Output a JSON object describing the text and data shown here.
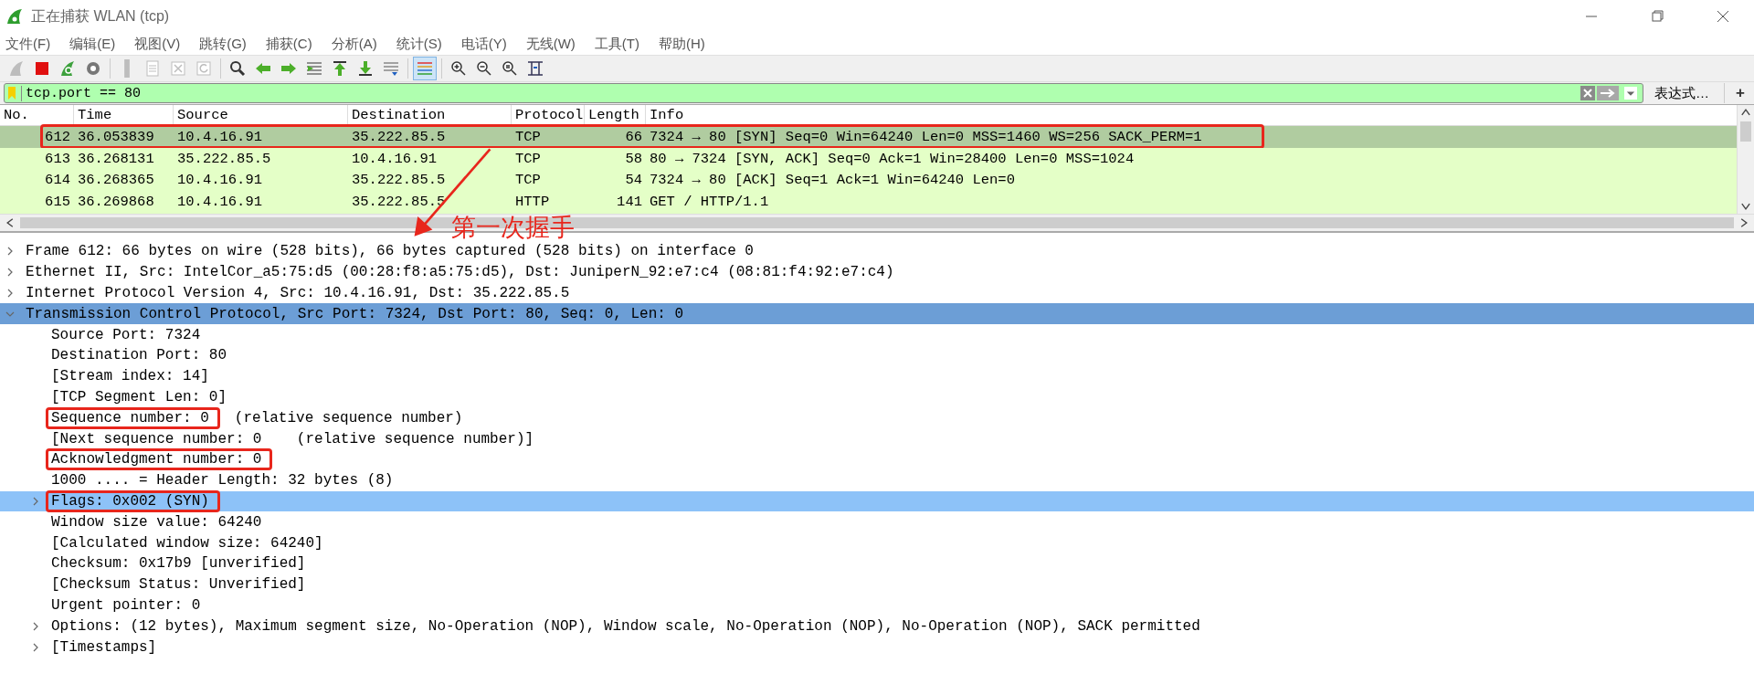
{
  "window": {
    "title": "正在捕获 WLAN (tcp)"
  },
  "menu": [
    "文件(F)",
    "编辑(E)",
    "视图(V)",
    "跳转(G)",
    "捕获(C)",
    "分析(A)",
    "统计(S)",
    "电话(Y)",
    "无线(W)",
    "工具(T)",
    "帮助(H)"
  ],
  "toolbar": [
    [
      {
        "kind": "start",
        "disabled": true,
        "pressed": false
      },
      {
        "kind": "stop",
        "disabled": false,
        "pressed": false
      },
      {
        "kind": "restart",
        "disabled": false,
        "pressed": false
      },
      {
        "kind": "options",
        "disabled": false,
        "pressed": false
      }
    ],
    [
      {
        "kind": "open",
        "disabled": true,
        "pressed": false
      },
      {
        "kind": "save",
        "disabled": true,
        "pressed": false
      },
      {
        "kind": "close",
        "disabled": true,
        "pressed": false
      },
      {
        "kind": "reload",
        "disabled": true,
        "pressed": false
      }
    ],
    [
      {
        "kind": "find",
        "disabled": false,
        "pressed": false
      },
      {
        "kind": "back",
        "disabled": false,
        "pressed": false
      },
      {
        "kind": "forward",
        "disabled": false,
        "pressed": false
      },
      {
        "kind": "goto",
        "disabled": false,
        "pressed": false
      },
      {
        "kind": "first",
        "disabled": false,
        "pressed": false
      },
      {
        "kind": "last",
        "disabled": false,
        "pressed": false
      },
      {
        "kind": "autoscroll",
        "disabled": false,
        "pressed": false
      }
    ],
    [
      {
        "kind": "colorize",
        "disabled": false,
        "pressed": true
      }
    ],
    [
      {
        "kind": "zoom_in",
        "disabled": false,
        "pressed": false
      },
      {
        "kind": "zoom_out",
        "disabled": false,
        "pressed": false
      },
      {
        "kind": "zoom_reset",
        "disabled": false,
        "pressed": false
      },
      {
        "kind": "resize",
        "disabled": false,
        "pressed": false
      }
    ]
  ],
  "filter": {
    "value": "tcp.port == 80",
    "expression_button": "表达式…",
    "add_button": "+"
  },
  "packet_list": {
    "columns": [
      "No.",
      "Time",
      "Source",
      "Destination",
      "Protocol",
      "Length",
      "Info"
    ],
    "rows": [
      {
        "no": "612",
        "time": "36.053839",
        "source": "10.4.16.91",
        "destination": "35.222.85.5",
        "protocol": "TCP",
        "length": "66",
        "info": "7324 → 80 [SYN] Seq=0 Win=64240 Len=0 MSS=1460 WS=256 SACK_PERM=1",
        "selected": true,
        "annotated": true
      },
      {
        "no": "613",
        "time": "36.268131",
        "source": "35.222.85.5",
        "destination": "10.4.16.91",
        "protocol": "TCP",
        "length": "58",
        "info": "80 → 7324 [SYN, ACK] Seq=0 Ack=1 Win=28400 Len=0 MSS=1024",
        "selected": false,
        "annotated": false
      },
      {
        "no": "614",
        "time": "36.268365",
        "source": "10.4.16.91",
        "destination": "35.222.85.5",
        "protocol": "TCP",
        "length": "54",
        "info": "7324 → 80 [ACK] Seq=1 Ack=1 Win=64240 Len=0",
        "selected": false,
        "annotated": false
      },
      {
        "no": "615",
        "time": "36.269868",
        "source": "10.4.16.91",
        "destination": "35.222.85.5",
        "protocol": "HTTP",
        "length": "141",
        "info": "GET / HTTP/1.1",
        "selected": false,
        "annotated": false
      }
    ]
  },
  "annotation": {
    "text": "第一次握手"
  },
  "details": [
    {
      "text": "Frame 612: 66 bytes on wire (528 bits), 66 bytes captured (528 bits) on interface 0",
      "expanded": false,
      "selected": false,
      "parent_of_selected": false,
      "annotated": false
    },
    {
      "text": "Ethernet II, Src: IntelCor_a5:75:d5 (00:28:f8:a5:75:d5), Dst: JuniperN_92:e7:c4 (08:81:f4:92:e7:c4)",
      "expanded": false,
      "selected": false,
      "parent_of_selected": false,
      "annotated": false
    },
    {
      "text": "Internet Protocol Version 4, Src: 10.4.16.91, Dst: 35.222.85.5",
      "expanded": false,
      "selected": false,
      "parent_of_selected": false,
      "annotated": false
    },
    {
      "text": "Transmission Control Protocol, Src Port: 7324, Dst Port: 80, Seq: 0, Len: 0",
      "expanded": true,
      "selected": false,
      "parent_of_selected": true,
      "annotated": false,
      "children": [
        {
          "text": "Source Port: 7324",
          "selected": false,
          "annotated": false
        },
        {
          "text": "Destination Port: 80",
          "selected": false,
          "annotated": false
        },
        {
          "text": "[Stream index: 14]",
          "selected": false,
          "annotated": false
        },
        {
          "text": "[TCP Segment Len: 0]",
          "selected": false,
          "annotated": false
        },
        {
          "text": "Sequence number: 0",
          "note": "(relative sequence number)",
          "selected": false,
          "annotated": true
        },
        {
          "text": "[Next sequence number: 0    (relative sequence number)]",
          "selected": false,
          "annotated": false
        },
        {
          "text": "Acknowledgment number: 0",
          "selected": false,
          "annotated": true
        },
        {
          "text": "1000 .... = Header Length: 32 bytes (8)",
          "selected": false,
          "annotated": false
        },
        {
          "text": "Flags: 0x002 (SYN)",
          "expanded": false,
          "selected": true,
          "annotated": true
        },
        {
          "text": "Window size value: 64240",
          "selected": false,
          "annotated": false
        },
        {
          "text": "[Calculated window size: 64240]",
          "selected": false,
          "annotated": false
        },
        {
          "text": "Checksum: 0x17b9 [unverified]",
          "selected": false,
          "annotated": false
        },
        {
          "text": "[Checksum Status: Unverified]",
          "selected": false,
          "annotated": false
        },
        {
          "text": "Urgent pointer: 0",
          "selected": false,
          "annotated": false
        },
        {
          "text": "Options: (12 bytes), Maximum segment size, No-Operation (NOP), Window scale, No-Operation (NOP), No-Operation (NOP), SACK permitted",
          "expanded": false,
          "selected": false,
          "annotated": false
        },
        {
          "text": "[Timestamps]",
          "expanded": false,
          "selected": false,
          "annotated": false
        }
      ]
    }
  ]
}
